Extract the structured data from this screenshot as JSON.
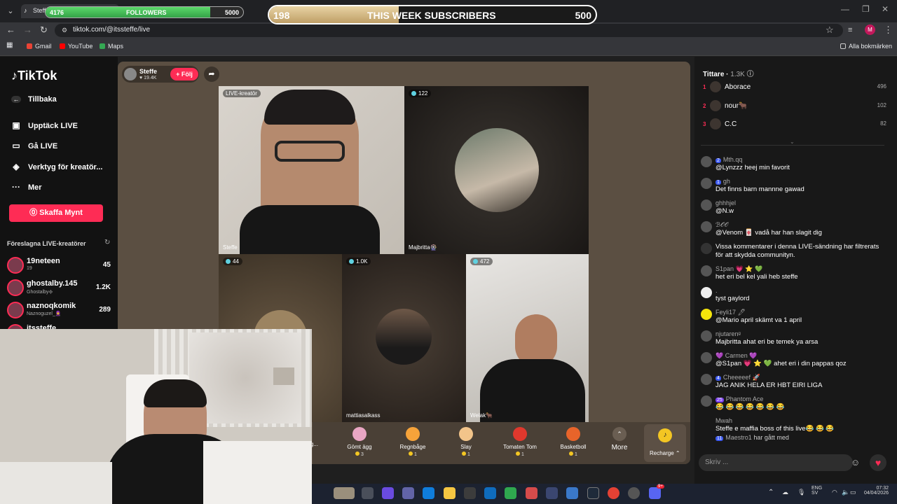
{
  "overlay": {
    "followers": {
      "current": "4176",
      "label": "FOLLOWERS",
      "goal": "5000",
      "progress": 0.835
    },
    "subscribers": {
      "current": "198",
      "label": "THIS WEEK SUBSCRIBERS",
      "goal": "500",
      "progress": 0.396
    }
  },
  "browser": {
    "tab_title": "Steffe",
    "url": "tiktok.com/@itssteffe/live",
    "profile_letter": "M",
    "bookmarks": [
      {
        "label": "Gmail",
        "color": "#ea4335"
      },
      {
        "label": "YouTube",
        "color": "#ff0000"
      },
      {
        "label": "Maps",
        "color": "#34a853"
      }
    ],
    "all_bookmarks": "Alla bokmärken"
  },
  "tiktok": {
    "logo": "TikTok",
    "nav": [
      {
        "label": "Tillbaka",
        "icon": "arrow-left-icon"
      },
      {
        "label": "Upptäck LIVE",
        "icon": "live-calendar-icon"
      },
      {
        "label": "Gå LIVE",
        "icon": "video-camera-icon"
      },
      {
        "label": "Verktyg för kreatör...",
        "icon": "compass-icon"
      },
      {
        "label": "Mer",
        "icon": "more-dots-icon"
      }
    ],
    "get_coins": "Skaffa Mynt",
    "suggested_title": "Föreslagna LIVE-kreatörer",
    "suggested": [
      {
        "name": "19neteen",
        "sub": "19",
        "count": "45"
      },
      {
        "name": "ghostalby.145",
        "sub": "Ghostalby᪣",
        "count": "1.2K"
      },
      {
        "name": "naznoqkomik",
        "sub": "Naznoguzel_🧕",
        "count": "289"
      },
      {
        "name": "itssteffe",
        "sub": "",
        "count": ""
      }
    ]
  },
  "live": {
    "host": {
      "name": "Steffe",
      "likes": "19.4K",
      "follow": "+ Följ"
    },
    "tiles": [
      {
        "badge": "LIVE-kreatör",
        "name": "Steffe"
      },
      {
        "badge": "122",
        "name": "Majbritta🎡"
      },
      {
        "badge": "44",
        "name": ""
      },
      {
        "badge": "1.0K",
        "name": "mattiasalkass"
      },
      {
        "badge": "472",
        "name": "Welak🐂"
      }
    ],
    "gifts": [
      {
        "name": "Göing...",
        "price": ""
      },
      {
        "name": "Gömt ägg",
        "price": "3",
        "color": "#e9a6c4"
      },
      {
        "name": "Regnbåge",
        "price": "1",
        "color": "#f6a33a"
      },
      {
        "name": "Slay",
        "price": "1",
        "color": "#f2c48a"
      },
      {
        "name": "Tomaten Tom",
        "price": "1",
        "color": "#e0382d"
      },
      {
        "name": "Basketboll",
        "price": "1",
        "color": "#e8642a"
      },
      {
        "name": "More",
        "price": ""
      },
      {
        "name": "Recharge",
        "price": ""
      }
    ]
  },
  "viewers": {
    "title": "Tittare",
    "count": "1.3K",
    "top": [
      {
        "rank": "1",
        "name": "Aborace",
        "score": "496"
      },
      {
        "rank": "2",
        "name": "nour🐂",
        "score": "102"
      },
      {
        "rank": "3",
        "name": "C.C",
        "score": "82"
      }
    ]
  },
  "comments": [
    {
      "level": "2",
      "user": "Mth.qq",
      "text": "@Lynzzz heej min favorit"
    },
    {
      "level": "1",
      "user": "gh",
      "text": "Det finns barn mannne gawad"
    },
    {
      "level": "",
      "user": "ghhhjel",
      "text": "@N.w"
    },
    {
      "level": "",
      "user": "ℬ𝒪𝒪",
      "text": "@Venom 🀄 vadå har han slagit dig"
    },
    {
      "level": "",
      "user": "",
      "text": "Vissa kommentarer i denna LIVE-sändning har filtrerats för att skydda communityn."
    },
    {
      "level": "",
      "user": "S1pan 💗 ⭐ 💚",
      "text": "het eri bel kel yali heb steffe"
    },
    {
      "level": "",
      "user": ".",
      "text": "tyst gaylord"
    },
    {
      "level": "",
      "user": "Feyli17 🖊",
      "text": "@Mario april skämt va 1 april"
    },
    {
      "level": "",
      "user": "njutarenᵍ",
      "text": "Majbritta ahat eri be temek ya arsa"
    },
    {
      "level": "",
      "user": "💜 Carmen 💜",
      "text": "@S1pan 💗 ⭐ 💚 ahet eri i din pappas qoz"
    },
    {
      "level": "4",
      "user": "Cheeeeef 🚀",
      "text": "JAG ANIK HELA ER HBT EIRI LIGA"
    },
    {
      "level": "25",
      "user": "Phantom Ace",
      "text": "😂 😂 😂 😂 😂 😂 😂"
    },
    {
      "level": "",
      "user": "Mwah",
      "text": "Steffe e maffia boss of this live😂 😂 😂"
    },
    {
      "level": "11",
      "user": "Maestro1",
      "text": "har gått med"
    }
  ],
  "chat_placeholder": "Skriv ...",
  "taskbar": {
    "lang": "ENG",
    "region": "SV",
    "time": "07:32",
    "date": "04/04/2026",
    "badge": "9+"
  }
}
